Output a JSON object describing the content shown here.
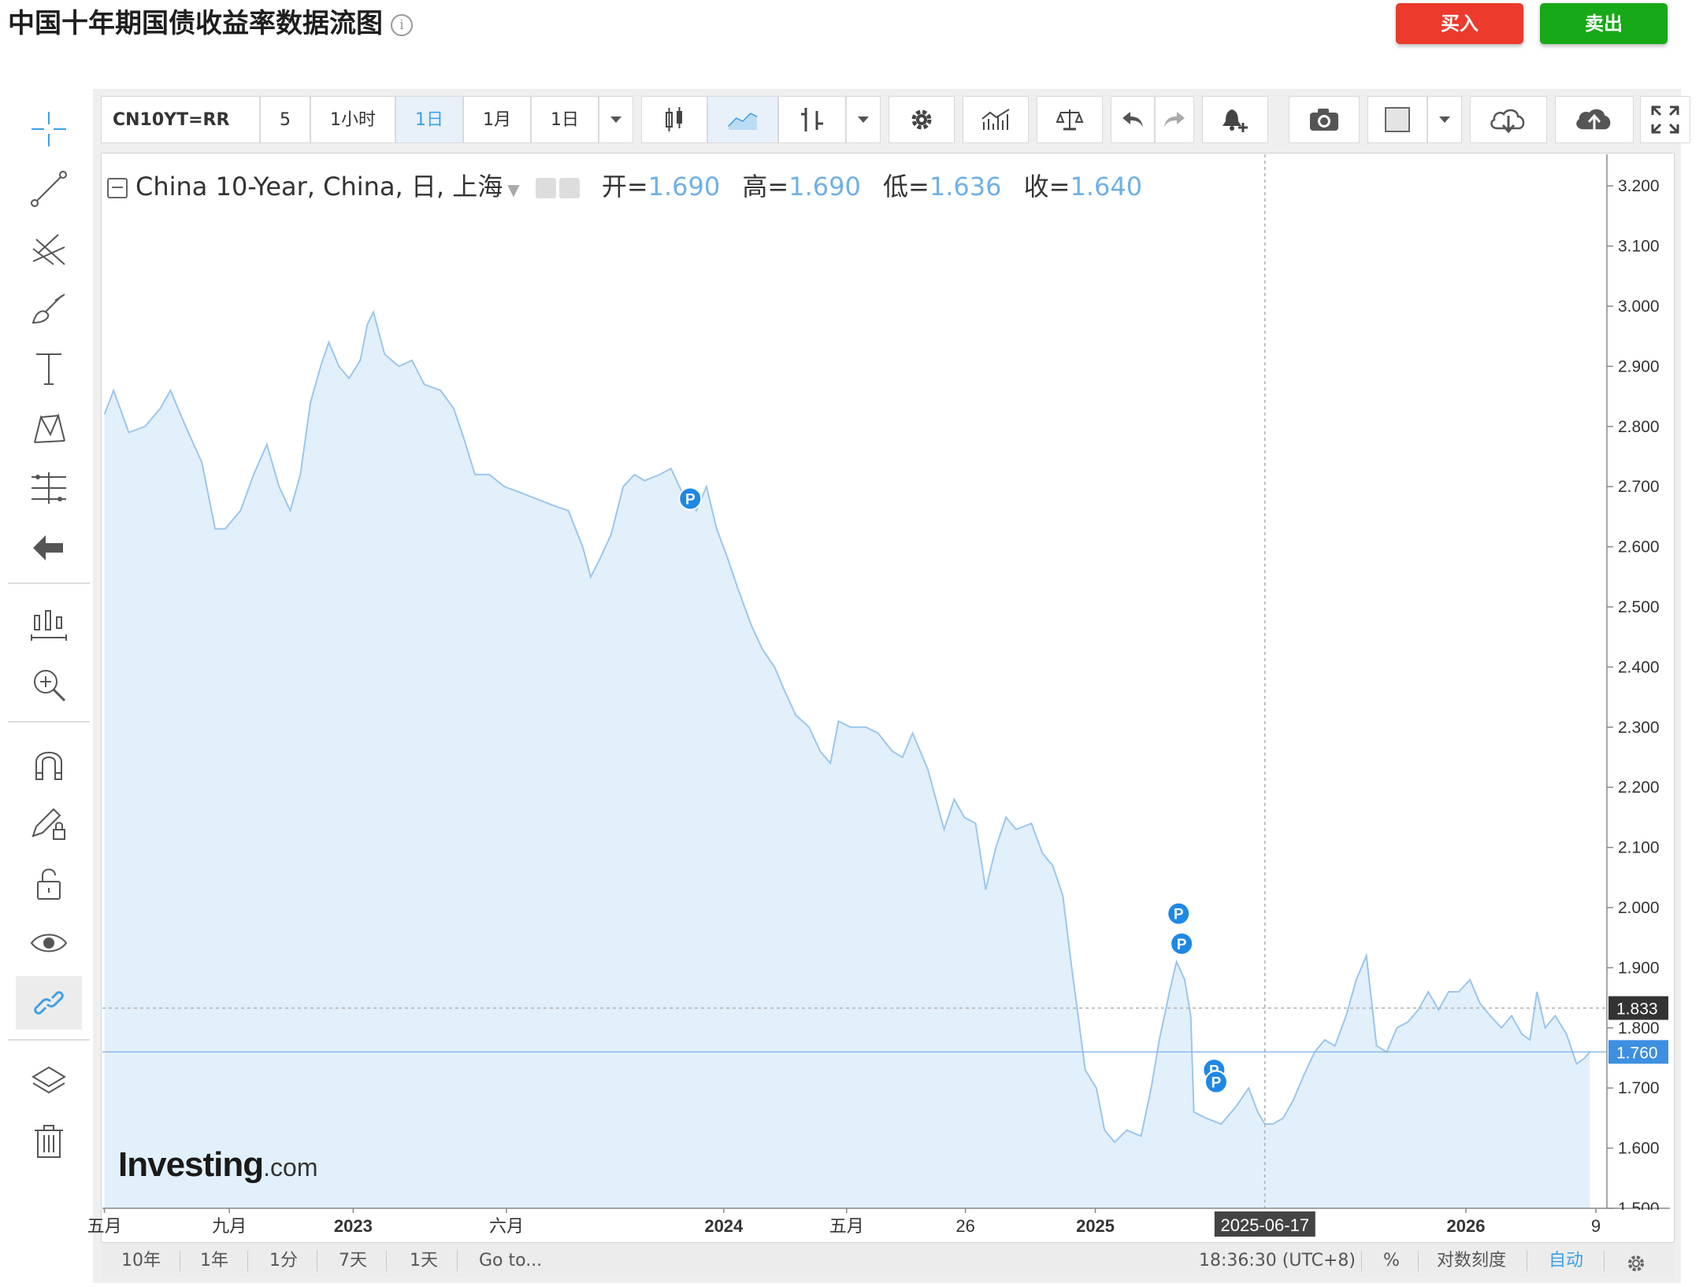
{
  "page": {
    "title": "中国十年期国债收益率数据流图",
    "info_icon": "info-icon",
    "buy_label": "买入",
    "sell_label": "卖出",
    "buy_color": "#ec3a2c",
    "sell_color": "#17a917"
  },
  "toolbar": {
    "symbol": "CN10YT=RR",
    "intervals": [
      "5",
      "1小时",
      "1日",
      "1月",
      "1日"
    ],
    "active_interval": "1日",
    "icons": [
      "dropdown-caret-icon",
      "candlestick-icon",
      "line-chart-icon",
      "bar-chart-type-icon",
      "dropdown-caret-icon",
      "settings-gear-icon",
      "indicators-icon",
      "compare-scale-icon",
      "undo-icon",
      "redo-icon",
      "alert-bell-icon",
      "camera-icon",
      "color-swatch-icon",
      "dropdown-caret-icon",
      "cloud-download-icon",
      "cloud-upload-icon",
      "fullscreen-icon"
    ]
  },
  "left_tools": [
    "crosshair-icon",
    "trend-line-icon",
    "pitchfork-icon",
    "brush-icon",
    "text-icon",
    "pattern-icon",
    "measure-icon",
    "back-arrow-icon",
    "zoom-out-candles-icon",
    "zoom-in-icon",
    "magnet-icon",
    "pencil-lock-icon",
    "unlock-icon",
    "eye-icon",
    "link-icon",
    "layers-icon",
    "trash-icon"
  ],
  "legend": {
    "name": "China 10-Year, China, 日, 上海",
    "open_label": "开=",
    "open": "1.690",
    "high_label": "高=",
    "high": "1.690",
    "low_label": "低=",
    "low": "1.636",
    "close_label": "收=",
    "close": "1.640"
  },
  "chart_data": {
    "type": "area",
    "series": [
      {
        "name": "China 10-Year",
        "color": "#9cc6ec",
        "fill": "#e2f0fb",
        "points": [
          [
            "2022-05-01",
            2.82
          ],
          [
            "2022-05-10",
            2.86
          ],
          [
            "2022-05-25",
            2.79
          ],
          [
            "2022-06-10",
            2.8
          ],
          [
            "2022-06-25",
            2.83
          ],
          [
            "2022-07-05",
            2.86
          ],
          [
            "2022-07-20",
            2.8
          ],
          [
            "2022-08-05",
            2.74
          ],
          [
            "2022-08-18",
            2.63
          ],
          [
            "2022-08-28",
            2.63
          ],
          [
            "2022-09-12",
            2.66
          ],
          [
            "2022-09-25",
            2.72
          ],
          [
            "2022-10-08",
            2.77
          ],
          [
            "2022-10-20",
            2.7
          ],
          [
            "2022-10-31",
            2.66
          ],
          [
            "2022-11-10",
            2.72
          ],
          [
            "2022-11-20",
            2.84
          ],
          [
            "2022-11-30",
            2.9
          ],
          [
            "2022-12-08",
            2.94
          ],
          [
            "2022-12-18",
            2.9
          ],
          [
            "2022-12-28",
            2.88
          ],
          [
            "2023-01-08",
            2.91
          ],
          [
            "2023-01-15",
            2.97
          ],
          [
            "2023-01-21",
            2.99
          ],
          [
            "2023-02-01",
            2.92
          ],
          [
            "2023-02-15",
            2.9
          ],
          [
            "2023-02-28",
            2.91
          ],
          [
            "2023-03-12",
            2.87
          ],
          [
            "2023-03-28",
            2.86
          ],
          [
            "2023-04-10",
            2.83
          ],
          [
            "2023-04-20",
            2.78
          ],
          [
            "2023-05-01",
            2.72
          ],
          [
            "2023-05-15",
            2.72
          ],
          [
            "2023-05-30",
            2.7
          ],
          [
            "2023-06-15",
            2.69
          ],
          [
            "2023-06-30",
            2.68
          ],
          [
            "2023-07-15",
            2.67
          ],
          [
            "2023-08-01",
            2.66
          ],
          [
            "2023-08-15",
            2.6
          ],
          [
            "2023-08-23",
            2.55
          ],
          [
            "2023-09-01",
            2.58
          ],
          [
            "2023-09-12",
            2.62
          ],
          [
            "2023-09-24",
            2.7
          ],
          [
            "2023-10-05",
            2.72
          ],
          [
            "2023-10-15",
            2.71
          ],
          [
            "2023-10-30",
            2.72
          ],
          [
            "2023-11-10",
            2.73
          ],
          [
            "2023-11-24",
            2.68
          ],
          [
            "2023-12-05",
            2.66
          ],
          [
            "2023-12-15",
            2.7
          ],
          [
            "2023-12-25",
            2.63
          ],
          [
            "2024-01-05",
            2.58
          ],
          [
            "2024-01-15",
            2.53
          ],
          [
            "2024-01-28",
            2.47
          ],
          [
            "2024-02-08",
            2.43
          ],
          [
            "2024-02-20",
            2.4
          ],
          [
            "2024-03-01",
            2.36
          ],
          [
            "2024-03-12",
            2.32
          ],
          [
            "2024-03-25",
            2.3
          ],
          [
            "2024-04-05",
            2.26
          ],
          [
            "2024-04-15",
            2.24
          ],
          [
            "2024-04-23",
            2.31
          ],
          [
            "2024-05-05",
            2.3
          ],
          [
            "2024-05-20",
            2.3
          ],
          [
            "2024-06-01",
            2.29
          ],
          [
            "2024-06-15",
            2.26
          ],
          [
            "2024-06-25",
            2.25
          ],
          [
            "2024-07-05",
            2.29
          ],
          [
            "2024-07-20",
            2.23
          ],
          [
            "2024-08-05",
            2.13
          ],
          [
            "2024-08-15",
            2.18
          ],
          [
            "2024-08-25",
            2.15
          ],
          [
            "2024-09-05",
            2.14
          ],
          [
            "2024-09-15",
            2.03
          ],
          [
            "2024-09-25",
            2.1
          ],
          [
            "2024-10-05",
            2.15
          ],
          [
            "2024-10-15",
            2.13
          ],
          [
            "2024-10-30",
            2.14
          ],
          [
            "2024-11-10",
            2.09
          ],
          [
            "2024-11-20",
            2.07
          ],
          [
            "2024-11-30",
            2.02
          ],
          [
            "2024-12-08",
            1.91
          ],
          [
            "2024-12-15",
            1.82
          ],
          [
            "2024-12-22",
            1.73
          ],
          [
            "2025-01-02",
            1.7
          ],
          [
            "2025-01-10",
            1.63
          ],
          [
            "2025-01-20",
            1.61
          ],
          [
            "2025-02-01",
            1.63
          ],
          [
            "2025-02-15",
            1.62
          ],
          [
            "2025-02-25",
            1.7
          ],
          [
            "2025-03-05",
            1.78
          ],
          [
            "2025-03-15",
            1.86
          ],
          [
            "2025-03-22",
            1.91
          ],
          [
            "2025-03-30",
            1.88
          ],
          [
            "2025-04-05",
            1.82
          ],
          [
            "2025-04-08",
            1.66
          ],
          [
            "2025-04-20",
            1.65
          ],
          [
            "2025-05-05",
            1.64
          ],
          [
            "2025-05-20",
            1.67
          ],
          [
            "2025-06-01",
            1.7
          ],
          [
            "2025-06-10",
            1.66
          ],
          [
            "2025-06-17",
            1.64
          ],
          [
            "2025-06-25",
            1.64
          ],
          [
            "2025-07-05",
            1.65
          ],
          [
            "2025-07-15",
            1.68
          ],
          [
            "2025-07-25",
            1.72
          ],
          [
            "2025-08-05",
            1.76
          ],
          [
            "2025-08-15",
            1.78
          ],
          [
            "2025-08-25",
            1.77
          ],
          [
            "2025-09-05",
            1.82
          ],
          [
            "2025-09-15",
            1.88
          ],
          [
            "2025-09-25",
            1.92
          ],
          [
            "2025-10-05",
            1.77
          ],
          [
            "2025-10-15",
            1.76
          ],
          [
            "2025-10-25",
            1.8
          ],
          [
            "2025-11-05",
            1.81
          ],
          [
            "2025-11-15",
            1.83
          ],
          [
            "2025-11-25",
            1.86
          ],
          [
            "2025-12-05",
            1.83
          ],
          [
            "2025-12-15",
            1.86
          ],
          [
            "2025-12-25",
            1.86
          ],
          [
            "2026-01-05",
            1.88
          ],
          [
            "2026-01-15",
            1.84
          ],
          [
            "2026-01-25",
            1.82
          ],
          [
            "2026-02-05",
            1.8
          ],
          [
            "2026-02-15",
            1.82
          ],
          [
            "2026-02-25",
            1.79
          ],
          [
            "2026-03-05",
            1.78
          ],
          [
            "2026-03-12",
            1.86
          ],
          [
            "2026-03-20",
            1.8
          ],
          [
            "2026-03-30",
            1.82
          ],
          [
            "2026-04-10",
            1.79
          ],
          [
            "2026-04-20",
            1.74
          ],
          [
            "2026-04-28",
            1.75
          ],
          [
            "2026-05-03",
            1.76
          ]
        ]
      }
    ],
    "y_ticks": [
      "3.200",
      "3.100",
      "3.000",
      "2.900",
      "2.800",
      "2.700",
      "2.600",
      "2.500",
      "2.400",
      "2.300",
      "2.200",
      "2.100",
      "2.000",
      "1.900",
      "1.800",
      "1.700",
      "1.600",
      "1.500"
    ],
    "ylim": [
      1.5,
      3.2
    ],
    "xlim": [
      "2022-04-29",
      "2026-05-09"
    ],
    "x_ticks": [
      {
        "label": "五月",
        "date": "2022-05-01"
      },
      {
        "label": "九月",
        "date": "2022-09-01"
      },
      {
        "label": "2023",
        "date": "2023-01-01"
      },
      {
        "label": "六月",
        "date": "2023-06-01"
      },
      {
        "label": "2024",
        "date": "2024-01-01"
      },
      {
        "label": "五月",
        "date": "2024-05-01"
      },
      {
        "label": "26",
        "date": "2024-08-26"
      },
      {
        "label": "2025",
        "date": "2025-01-01"
      },
      {
        "label": "2026",
        "date": "2026-01-01"
      },
      {
        "label": "9",
        "date": "2026-05-09"
      }
    ],
    "cursor_date": "2025-06-17",
    "cursor_value": 1.833,
    "cursor_label": "1.833",
    "last_value": 1.76,
    "last_label": "1.760",
    "grid": false,
    "markers": [
      {
        "label": "P",
        "date": "2023-11-29",
        "value": 2.68
      },
      {
        "label": "P",
        "date": "2025-03-24",
        "value": 1.99
      },
      {
        "label": "P",
        "date": "2025-03-27",
        "value": 1.94
      },
      {
        "label": "P",
        "date": "2025-04-28",
        "value": 1.73
      },
      {
        "label": "P",
        "date": "2025-04-30",
        "value": 1.71
      }
    ]
  },
  "watermark": {
    "brand": "Investing",
    "suffix": ".com"
  },
  "bottom_bar": {
    "ranges": [
      "10年",
      "1年",
      "1分",
      "7天",
      "1天",
      "Go to..."
    ],
    "time": "18:36:30 (UTC+8)",
    "percent": "%",
    "log_scale": "对数刻度",
    "auto": "自动",
    "settings_icon": "settings-gear-icon"
  }
}
